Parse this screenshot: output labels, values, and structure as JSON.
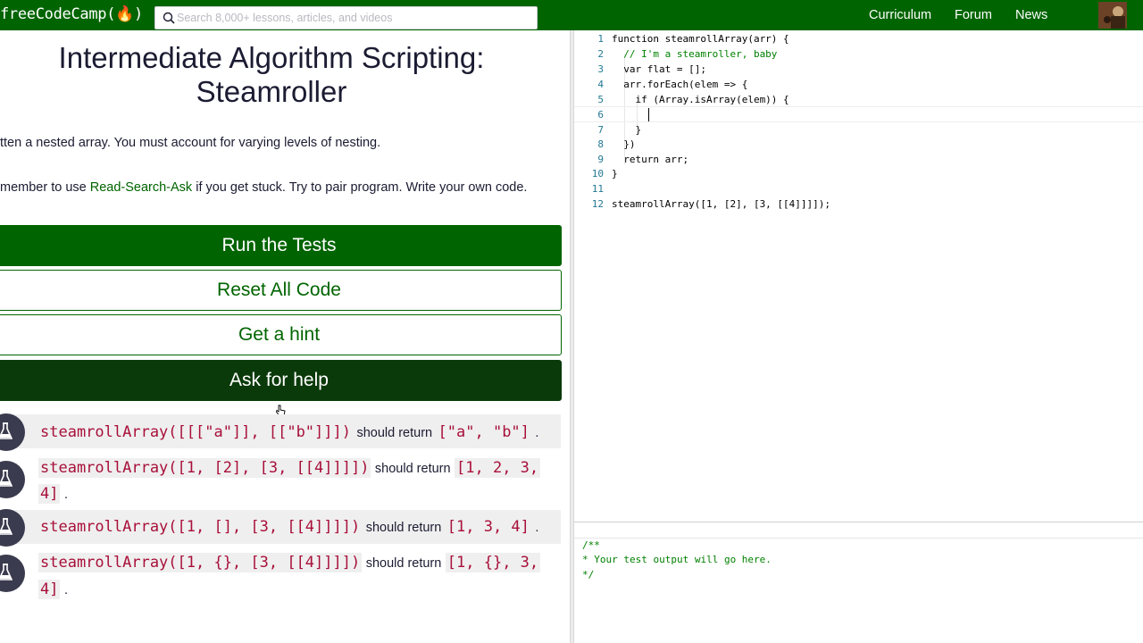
{
  "nav": {
    "logo": "freeCodeCamp(🔥)",
    "search_placeholder": "Search 8,000+ lessons, articles, and videos",
    "links": [
      "Curriculum",
      "Forum",
      "News"
    ]
  },
  "challenge": {
    "title_line1": "Intermediate Algorithm Scripting:",
    "title_line2": "Steamroller",
    "desc1": "tten a nested array. You must account for varying levels of nesting.",
    "desc2_pre": "member to use ",
    "desc2_link": "Read-Search-Ask",
    "desc2_post": " if you get stuck. Try to pair program. Write your own code."
  },
  "buttons": {
    "run": "Run the Tests",
    "reset": "Reset All Code",
    "hint": "Get a hint",
    "help": "Ask for help"
  },
  "tests": [
    {
      "call": "steamrollArray([[[\"a\"]], [[\"b\"]]])",
      "mid": "should return",
      "ret": "[\"a\", \"b\"]",
      "end": "."
    },
    {
      "call": "steamrollArray([1, [2], [3, [[4]]]])",
      "mid": "should return",
      "ret": "[1, 2, 3,",
      "ret2": "4]",
      "end": "."
    },
    {
      "call": "steamrollArray([1, [], [3, [[4]]]])",
      "mid": "should return",
      "ret": "[1, 3, 4]",
      "end": "."
    },
    {
      "call": "steamrollArray([1, {}, [3, [[4]]]])",
      "mid": "should return",
      "ret": "[1, {}, 3,",
      "ret2": "4]",
      "end": "."
    }
  ],
  "editor": {
    "line_numbers": [
      "1",
      "2",
      "3",
      "4",
      "5",
      "6",
      "7",
      "8",
      "9",
      "10",
      "11",
      "12"
    ],
    "lines": [
      "function steamrollArray(arr) {",
      "  // I'm a steamroller, baby",
      "  var flat = [];",
      "  arr.forEach(elem => {",
      "    if (Array.isArray(elem)) {",
      "      ",
      "    }",
      "  })",
      "  return arr;",
      "}",
      "",
      "steamrollArray([1, [2], [3, [[4]]]]);"
    ]
  },
  "output": {
    "lines": [
      "/**",
      "* Your test output will go here.",
      "*/"
    ]
  },
  "colors": {
    "brand_green": "#006400",
    "dark_green": "#0a3a0a",
    "code_red": "#a8103a"
  }
}
